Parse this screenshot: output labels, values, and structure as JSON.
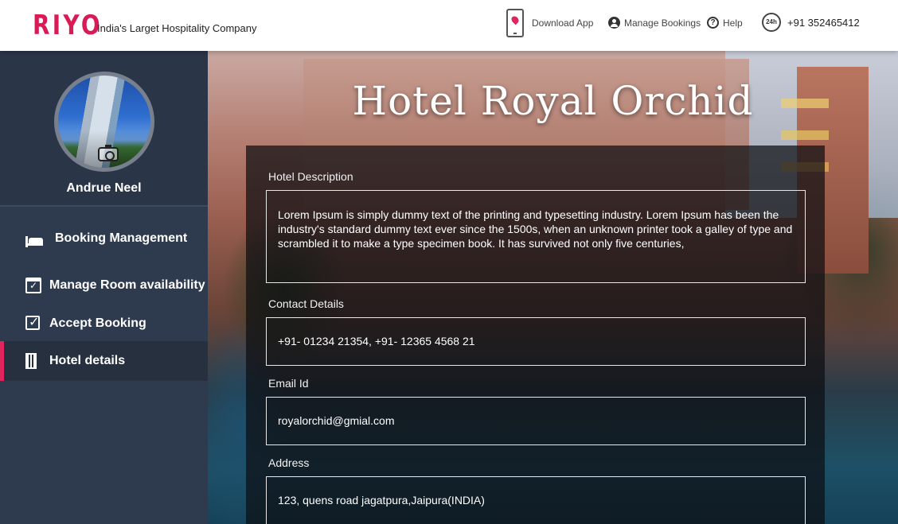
{
  "header": {
    "logo": "RIYO",
    "tagline": "India's Larget Hospitality Company",
    "download_app": "Download App",
    "manage_bookings": "Manage Bookings",
    "help": "Help",
    "hours_badge": "24h",
    "phone": "+91 352465412"
  },
  "sidebar": {
    "profile_name": "Andrue Neel",
    "items": [
      {
        "label": "Booking Management",
        "icon": "bed-icon"
      },
      {
        "label": "Manage Room availability",
        "icon": "calendar-check-icon"
      },
      {
        "label": "Accept Booking",
        "icon": "checkbox-icon"
      },
      {
        "label": "Hotel details",
        "icon": "building-icon",
        "active": true
      }
    ]
  },
  "main": {
    "title": "Hotel Royal Orchid",
    "fields": [
      {
        "label": "Hotel Description",
        "value": "Lorem Ipsum is simply dummy text of the printing and typesetting industry. Lorem Ipsum has been the industry's standard dummy text ever since the 1500s, when an unknown printer took a galley of type and scrambled it to make a type specimen book. It has survived not only five centuries,"
      },
      {
        "label": "Contact Details",
        "value": "+91- 01234 21354,  +91- 12365 4568 21"
      },
      {
        "label": "Email Id",
        "value": "royalorchid@gmial.com"
      },
      {
        "label": "Address",
        "value": "123, quens road jagatpura,Jaipura(INDIA)"
      }
    ]
  },
  "colors": {
    "accent": "#e0245e",
    "sidebar_bg": "#2e3a4e",
    "active_bg": "#26303f"
  }
}
